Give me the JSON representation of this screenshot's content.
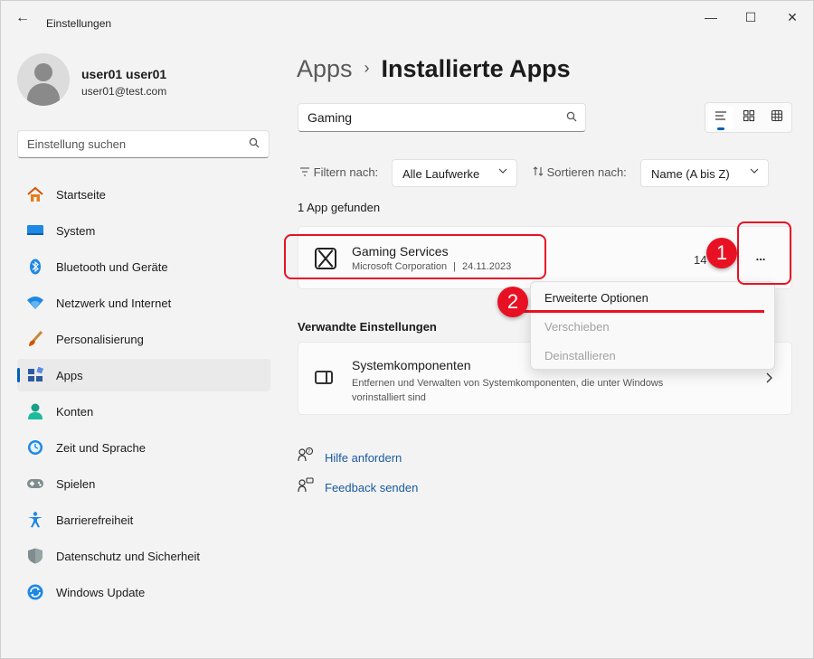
{
  "window": {
    "title": "Einstellungen",
    "back_glyph": "←",
    "minimize_glyph": "—",
    "maximize_glyph": "☐",
    "close_glyph": "✕"
  },
  "profile": {
    "name": "user01 user01",
    "email": "user01@test.com"
  },
  "sidebar": {
    "search_placeholder": "Einstellung suchen",
    "items": [
      {
        "label": "Startseite",
        "icon": "home-icon",
        "color": "#e67e22"
      },
      {
        "label": "System",
        "icon": "system-icon",
        "color": "#1e88e5"
      },
      {
        "label": "Bluetooth und Geräte",
        "icon": "bluetooth-icon",
        "color": "#1e88e5"
      },
      {
        "label": "Netzwerk und Internet",
        "icon": "wifi-icon",
        "color": "#1e88e5"
      },
      {
        "label": "Personalisierung",
        "icon": "brush-icon",
        "color": "#d35400"
      },
      {
        "label": "Apps",
        "icon": "apps-icon",
        "color": "#2c5aa0"
      },
      {
        "label": "Konten",
        "icon": "accounts-icon",
        "color": "#16a085"
      },
      {
        "label": "Zeit und Sprache",
        "icon": "time-language-icon",
        "color": "#1e88e5"
      },
      {
        "label": "Spielen",
        "icon": "gaming-icon",
        "color": "#7f8c8d"
      },
      {
        "label": "Barrierefreiheit",
        "icon": "accessibility-icon",
        "color": "#1e88e5"
      },
      {
        "label": "Datenschutz und Sicherheit",
        "icon": "shield-icon",
        "color": "#7f8c8d"
      },
      {
        "label": "Windows Update",
        "icon": "update-icon",
        "color": "#1e88e5"
      }
    ],
    "active_index": 5
  },
  "breadcrumb": {
    "parent": "Apps",
    "separator": "›",
    "current": "Installierte Apps"
  },
  "search": {
    "value": "Gaming"
  },
  "view_switch": [
    "list-view-icon",
    "tile-view-icon",
    "grid-view-icon"
  ],
  "filter": {
    "label": "Filtern nach:",
    "value": "Alle Laufwerke"
  },
  "sort": {
    "label": "Sortieren nach:",
    "value": "Name (A bis Z)"
  },
  "results_text": "1 App gefunden",
  "app": {
    "name": "Gaming Services",
    "publisher": "Microsoft Corporation",
    "separator": "|",
    "date": "24.11.2023",
    "size_partial": "14",
    "more_label": "..."
  },
  "context_menu": {
    "items": [
      {
        "label": "Erweiterte Optionen",
        "enabled": true
      },
      {
        "label": "Verschieben",
        "enabled": false
      },
      {
        "label": "Deinstallieren",
        "enabled": false
      }
    ]
  },
  "related": {
    "heading": "Verwandte Einstellungen",
    "title": "Systemkomponenten",
    "description": "Entfernen und Verwalten von Systemkomponenten, die unter Windows vorinstalliert sind"
  },
  "links": {
    "help": "Hilfe anfordern",
    "feedback": "Feedback senden"
  },
  "annotations": {
    "step1": "1",
    "step2": "2",
    "color": "#e81123"
  }
}
